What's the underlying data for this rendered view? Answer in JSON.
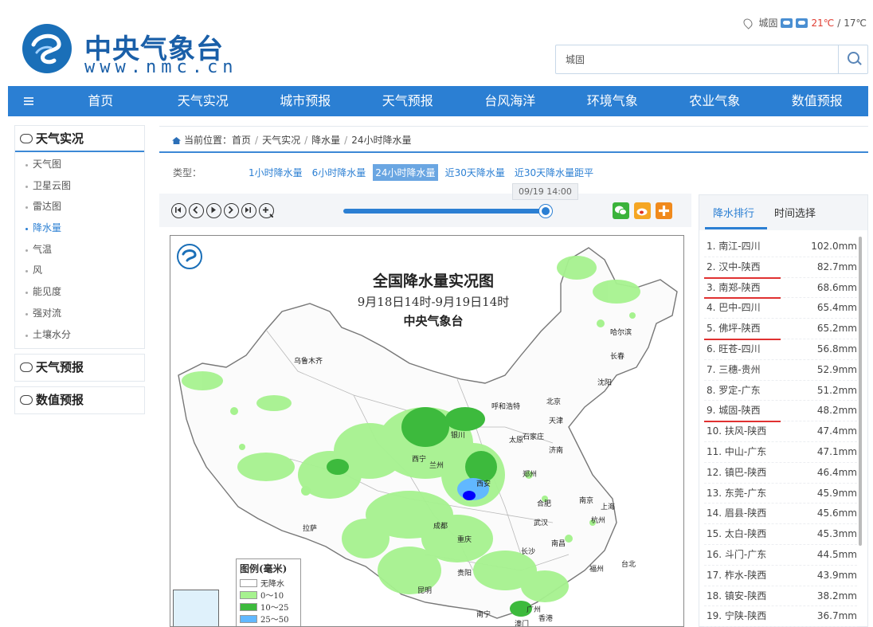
{
  "header": {
    "site_name": "中央气象台",
    "site_url": "www.nmc.cn",
    "location": "城固",
    "temp_high": "21℃",
    "temp_sep": " / ",
    "temp_low": "17℃",
    "search_value": "城固",
    "search_placeholder": ""
  },
  "nav": {
    "items": [
      "首页",
      "天气实况",
      "城市预报",
      "天气预报",
      "台风海洋",
      "环境气象",
      "农业气象",
      "数值预报"
    ]
  },
  "sidebar": {
    "groups": [
      {
        "title": "天气实况",
        "items": [
          "天气图",
          "卫星云图",
          "雷达图",
          "降水量",
          "气温",
          "风",
          "能见度",
          "强对流",
          "土壤水分"
        ],
        "selected": "降水量"
      },
      {
        "title": "天气预报"
      },
      {
        "title": "数值预报"
      }
    ]
  },
  "breadcrumb": {
    "prefix": "当前位置：",
    "items": [
      "首页",
      "天气实况",
      "降水量",
      "24小时降水量"
    ]
  },
  "type_selector": {
    "label": "类型：",
    "options": [
      "1小时降水量",
      "6小时降水量",
      "24小时降水量",
      "近30天降水量",
      "近30天降水量距平"
    ],
    "selected": "24小时降水量"
  },
  "player": {
    "time_tip": "09/19 14:00",
    "controls": [
      "first-frame-icon",
      "prev-frame-icon",
      "play-icon",
      "next-frame-icon",
      "last-frame-icon",
      "zoom-in-icon"
    ],
    "progress": 1.0,
    "share": [
      "wechat-icon",
      "weibo-icon",
      "more-share-icon"
    ]
  },
  "map": {
    "title": "全国降水量实况图",
    "subtitle": "9月18日14时-9月19日14时",
    "source": "中央气象台",
    "cities": [
      "乌鲁木齐",
      "哈尔滨",
      "长春",
      "沈阳",
      "呼和浩特",
      "北京",
      "天津",
      "银川",
      "石家庄",
      "太原",
      "济南",
      "西宁",
      "兰州",
      "西安",
      "郑州",
      "合肥",
      "南京",
      "上海",
      "拉萨",
      "成都",
      "武汉",
      "杭州",
      "重庆",
      "长沙",
      "南昌",
      "福州",
      "贵阳",
      "台北",
      "昆明",
      "南宁",
      "广州",
      "香港",
      "澳门"
    ],
    "legend": {
      "title": "图例(毫米)",
      "items": [
        {
          "label": "无降水",
          "color": "#ffffff"
        },
        {
          "label": "0～10",
          "color": "#a6f28f"
        },
        {
          "label": "10～25",
          "color": "#3dba3d"
        },
        {
          "label": "25～50",
          "color": "#61b8ff"
        }
      ]
    },
    "colors": {
      "light": "#a6f28f",
      "medium": "#3dba3d",
      "heavy": "#61b8ff",
      "storm": "#0000fe"
    }
  },
  "ranking": {
    "tabs": [
      "降水排行",
      "时间选择"
    ],
    "rows": [
      {
        "name": "1. 南江-四川",
        "value": "102.0mm",
        "marked": false
      },
      {
        "name": "2. 汉中-陕西",
        "value": "82.7mm",
        "marked": true
      },
      {
        "name": "3. 南郑-陕西",
        "value": "68.6mm",
        "marked": true
      },
      {
        "name": "4. 巴中-四川",
        "value": "65.4mm",
        "marked": false
      },
      {
        "name": "5. 佛坪-陕西",
        "value": "65.2mm",
        "marked": true
      },
      {
        "name": "6. 旺苍-四川",
        "value": "56.8mm",
        "marked": false
      },
      {
        "name": "7. 三穗-贵州",
        "value": "52.9mm",
        "marked": false
      },
      {
        "name": "8. 罗定-广东",
        "value": "51.2mm",
        "marked": false
      },
      {
        "name": "9. 城固-陕西",
        "value": "48.2mm",
        "marked": true
      },
      {
        "name": "10. 扶风-陕西",
        "value": "47.4mm",
        "marked": false
      },
      {
        "name": "11. 中山-广东",
        "value": "47.1mm",
        "marked": false
      },
      {
        "name": "12. 镇巴-陕西",
        "value": "46.4mm",
        "marked": false
      },
      {
        "name": "13. 东莞-广东",
        "value": "45.9mm",
        "marked": false
      },
      {
        "name": "14. 眉县-陕西",
        "value": "45.6mm",
        "marked": false
      },
      {
        "name": "15. 太白-陕西",
        "value": "45.3mm",
        "marked": false
      },
      {
        "name": "16. 斗门-广东",
        "value": "44.5mm",
        "marked": false
      },
      {
        "name": "17. 柞水-陕西",
        "value": "43.9mm",
        "marked": false
      },
      {
        "name": "18. 镇安-陕西",
        "value": "38.2mm",
        "marked": false
      },
      {
        "name": "19. 宁陕-陕西",
        "value": "36.7mm",
        "marked": false
      }
    ]
  }
}
